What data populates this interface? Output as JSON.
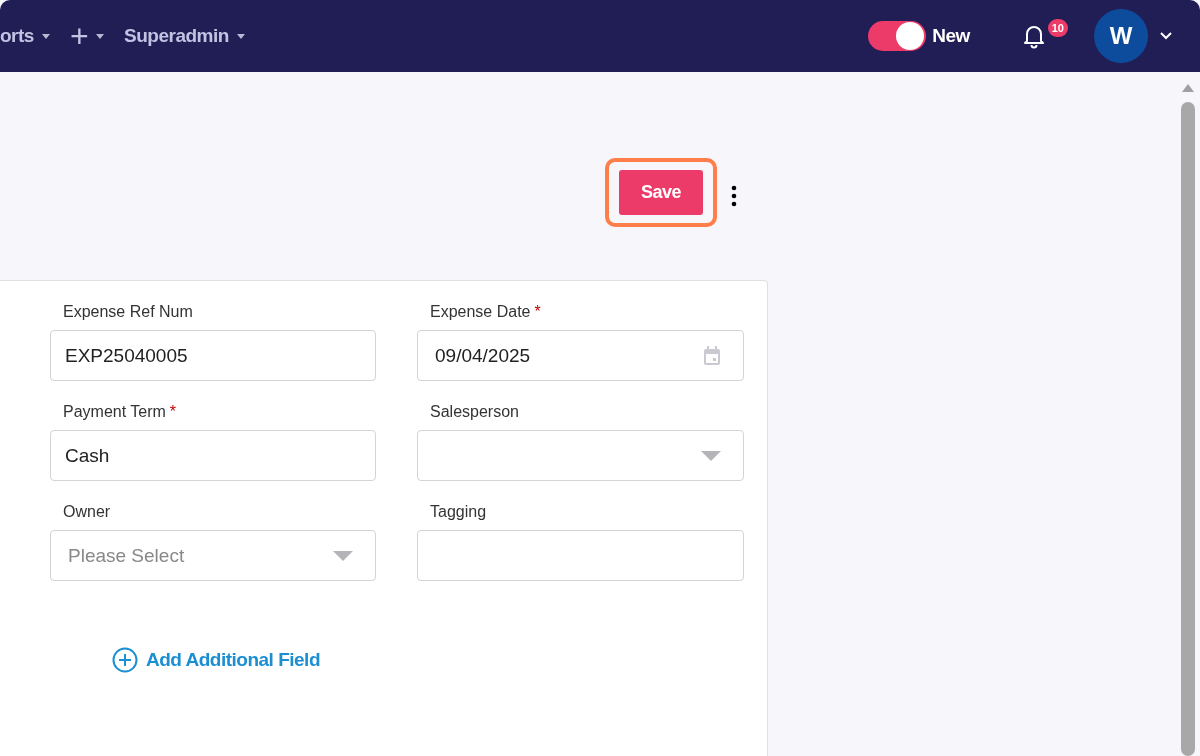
{
  "nav": {
    "menus": [
      {
        "label": "orts"
      },
      {
        "label": "+",
        "kind": "icon"
      },
      {
        "label": "Superadmin"
      }
    ],
    "toggle": {
      "on": true,
      "label": "New"
    },
    "notifications": {
      "count": "10"
    },
    "avatar": {
      "initial": "W"
    }
  },
  "toolbar": {
    "save": "Save",
    "highlighted": true
  },
  "form": {
    "fields": [
      {
        "label": "Expense Ref Num",
        "required": false,
        "kind": "text",
        "value": "EXP25040005"
      },
      {
        "label": "Expense Date",
        "required": true,
        "kind": "date",
        "value": "09/04/2025"
      },
      {
        "label": "Payment Term",
        "required": true,
        "kind": "text",
        "value": "Cash"
      },
      {
        "label": "Salesperson",
        "required": false,
        "kind": "select"
      },
      {
        "label": "Owner",
        "required": false,
        "kind": "select",
        "placeholder": "Please Select"
      },
      {
        "label": "Tagging",
        "required": false,
        "kind": "text"
      }
    ],
    "required_mark": "*",
    "add_field": "Add Additional Field"
  }
}
